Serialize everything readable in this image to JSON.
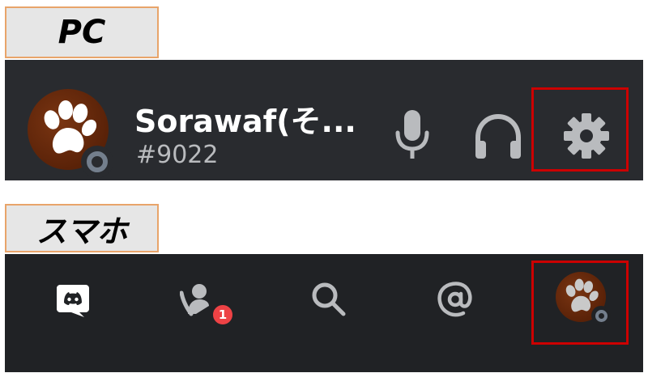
{
  "labels": {
    "pc": "PC",
    "smartphone": "スマホ"
  },
  "pc_panel": {
    "username": "Sorawaf(そ...",
    "tag": "#9022",
    "avatar_icon": "paw-print-avatar",
    "status": "offline",
    "buttons": [
      "microphone-icon",
      "headphones-icon",
      "settings-gear-icon"
    ]
  },
  "mobile_nav": {
    "items": [
      "home-discord-icon",
      "friends-icon",
      "search-icon",
      "mentions-icon",
      "profile-avatar"
    ],
    "friends_badge": "1"
  },
  "colors": {
    "pc_background": "#292b2f",
    "mobile_background": "#202225",
    "highlight": "#cc0000",
    "label_border": "#e8a46a",
    "badge": "#ed4245",
    "avatar": "#5a2208"
  }
}
